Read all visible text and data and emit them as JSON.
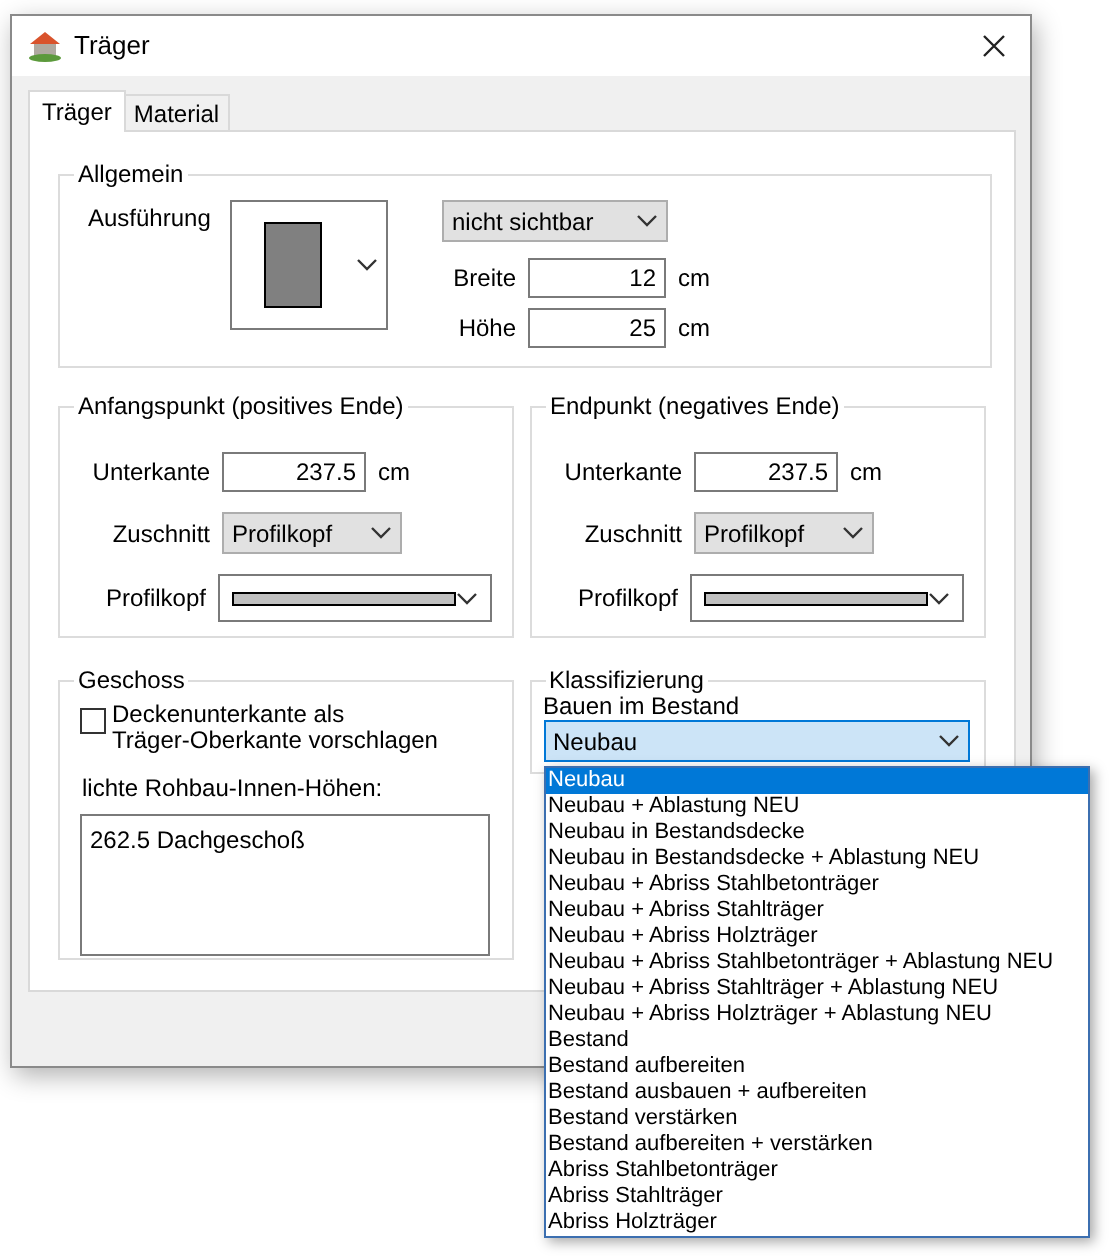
{
  "window": {
    "title": "Träger"
  },
  "tabs": [
    {
      "label": "Träger",
      "selected": true
    },
    {
      "label": "Material",
      "selected": false
    }
  ],
  "allgemein": {
    "title": "Allgemein",
    "ausfuehrung_label": "Ausführung",
    "visibility_select": "nicht sichtbar",
    "fields": [
      {
        "label": "Breite",
        "value": "12",
        "unit": "cm"
      },
      {
        "label": "Höhe",
        "value": "25",
        "unit": "cm"
      }
    ]
  },
  "ends": [
    {
      "title": "Anfangspunkt (positives Ende)",
      "unterkante_label": "Unterkante",
      "unterkante_value": "237.5",
      "unit": "cm",
      "zuschnitt_label": "Zuschnitt",
      "zuschnitt_value": "Profilkopf",
      "profilkopf_label": "Profilkopf"
    },
    {
      "title": "Endpunkt (negatives Ende)",
      "unterkante_label": "Unterkante",
      "unterkante_value": "237.5",
      "unit": "cm",
      "zuschnitt_label": "Zuschnitt",
      "zuschnitt_value": "Profilkopf",
      "profilkopf_label": "Profilkopf"
    }
  ],
  "geschoss": {
    "title": "Geschoss",
    "checkbox": {
      "label": "Deckenunterkante als\nTräger-Oberkante vorschlagen",
      "checked": false
    },
    "heights_label": "lichte Rohbau-Innen-Höhen:",
    "heights": [
      "262.5 Dachgeschoß"
    ]
  },
  "klassifizierung": {
    "title": "Klassifizierung",
    "label": "Bauen im Bestand",
    "value": "Neubau",
    "options": [
      {
        "label": "Neubau",
        "selected": true
      },
      {
        "label": "Neubau + Ablastung NEU",
        "selected": false
      },
      {
        "label": "Neubau in Bestandsdecke",
        "selected": false
      },
      {
        "label": "Neubau in Bestandsdecke + Ablastung NEU",
        "selected": false
      },
      {
        "label": "Neubau + Abriss Stahlbetonträger",
        "selected": false
      },
      {
        "label": "Neubau + Abriss Stahlträger",
        "selected": false
      },
      {
        "label": "Neubau + Abriss Holzträger",
        "selected": false
      },
      {
        "label": "Neubau + Abriss Stahlbetonträger + Ablastung NEU",
        "selected": false
      },
      {
        "label": "Neubau + Abriss Stahlträger + Ablastung NEU",
        "selected": false
      },
      {
        "label": "Neubau + Abriss Holzträger + Ablastung NEU",
        "selected": false
      },
      {
        "label": "Bestand",
        "selected": false
      },
      {
        "label": "Bestand aufbereiten",
        "selected": false
      },
      {
        "label": "Bestand ausbauen + aufbereiten",
        "selected": false
      },
      {
        "label": "Bestand verstärken",
        "selected": false
      },
      {
        "label": "Bestand aufbereiten + verstärken",
        "selected": false
      },
      {
        "label": "Abriss Stahlbetonträger",
        "selected": false
      },
      {
        "label": "Abriss Stahlträger",
        "selected": false
      },
      {
        "label": "Abriss Holzträger",
        "selected": false
      }
    ]
  }
}
